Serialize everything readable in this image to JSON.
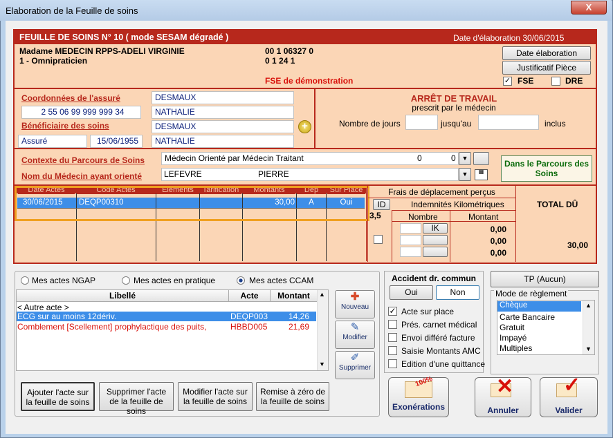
{
  "window": {
    "title": "Elaboration de la Feuille de soins",
    "close_glyph": "X"
  },
  "header": {
    "left": "FEUILLE DE SOINS  N° 10 ( mode SESAM dégradé )",
    "right": "Date d'élaboration 30/06/2015"
  },
  "practitioner": {
    "name": "Madame MEDECIN RPPS-ADELI VIRGINIE",
    "specialty": "1 - Omnipraticien",
    "code1": "00 1 06327 0",
    "code2": "0 1 24 1",
    "fse_demo": "FSE de démonstration"
  },
  "buttons_top": {
    "date_elaboration": "Date élaboration",
    "justificatif": "Justificatif Pièce"
  },
  "checks_top": {
    "fse": "FSE",
    "dre": "DRE"
  },
  "assure": {
    "label": "Coordonnées de l'assuré",
    "nir": "2 55 06 99 999 999 34",
    "nom": "DESMAUX",
    "prenom": "NATHALIE"
  },
  "beneficiaire": {
    "label": "Bénéficiaire des soins",
    "qualite": "Assuré",
    "date_naissance": "15/06/1955",
    "nom": "DESMAUX",
    "prenom": "NATHALIE"
  },
  "arret": {
    "title": "ARRÊT DE TRAVAIL",
    "subtitle": "prescrit par le médecin",
    "jours_label": "Nombre de jours",
    "jusquau_label": "jusqu'au",
    "inclus_label": "inclus"
  },
  "parcours": {
    "label": "Contexte du Parcours de Soins",
    "value": "Médecin Orienté par Médecin Traitant",
    "num1": "0",
    "num2": "0",
    "status": "Dans le Parcours des Soins"
  },
  "medecin_oriente": {
    "label": "Nom du Médecin ayant orienté",
    "nom": "LEFEVRE",
    "prenom": "PIERRE"
  },
  "actes_grid": {
    "columns": [
      "Date Actes",
      "Code Actes",
      "Eléments",
      "Tarification",
      "Montants",
      "Dep",
      "Sur Place"
    ],
    "rows": [
      [
        "30/06/2015",
        "DEQP00310",
        "",
        "",
        "30,00",
        "A",
        "Oui"
      ]
    ]
  },
  "frais": {
    "title": "Frais de déplacement perçus",
    "id_label": "ID",
    "indemnites": "Indemnités Kilométriques",
    "coef": "3,5",
    "nombre": "Nombre",
    "montant": "Montant",
    "ik_label": "IK",
    "montants": [
      "0,00",
      "0,00",
      "0,00"
    ]
  },
  "total": {
    "label": "TOTAL DÛ",
    "value": "30,00"
  },
  "mes_actes": {
    "options": [
      "Mes actes NGAP",
      "Mes actes en pratique",
      "Mes actes CCAM"
    ],
    "selected": "Mes actes CCAM",
    "columns": [
      "Libellé",
      "Acte",
      "Montant"
    ],
    "rows": [
      {
        "libelle": "< Autre acte >",
        "acte": "",
        "montant": ""
      },
      {
        "libelle": "ECG sur au moins 12dériv.",
        "acte": "DEQP003",
        "montant": "14,26"
      },
      {
        "libelle": "Comblement [Scellement] prophylactique des puits,",
        "acte": "HBBD005",
        "montant": "21,69"
      }
    ]
  },
  "side_buttons": {
    "nouveau": "Nouveau",
    "modifier": "Modifier",
    "supprimer": "Supprimer"
  },
  "bottom_buttons": {
    "ajouter": "Ajouter l'acte sur la feuille de soins",
    "supprimer": "Supprimer l'acte de la feuille de soins",
    "modifier": "Modifier l'acte sur la feuille de soins",
    "remise": "Remise à zéro de la feuille de soins"
  },
  "accident": {
    "title": "Accident dr. commun",
    "oui": "Oui",
    "non": "Non"
  },
  "options": [
    {
      "label": "Acte sur place",
      "checked": true
    },
    {
      "label": "Prés. carnet médical",
      "checked": false
    },
    {
      "label": "Envoi différé facture",
      "checked": false
    },
    {
      "label": "Saisie Montants AMC",
      "checked": false
    },
    {
      "label": "Edition d'une quittance",
      "checked": false
    }
  ],
  "tp": {
    "label": "TP (Aucun)"
  },
  "reglement": {
    "title": "Mode de règlement",
    "items": [
      "Chèque",
      "Carte Bancaire",
      "Gratuit",
      "Impayé",
      "Multiples"
    ],
    "selected": "Chèque"
  },
  "action_buttons": {
    "exonerations": "Exonérations",
    "annuler": "Annuler",
    "valider": "Valider",
    "badge": "100%"
  },
  "colors": {
    "accent_red": "#b7281c",
    "panel_bg": "#fbd6b6",
    "selection": "#3d8ee8",
    "highlight_border": "#f0a020",
    "status_green": "#0a6a0a"
  }
}
